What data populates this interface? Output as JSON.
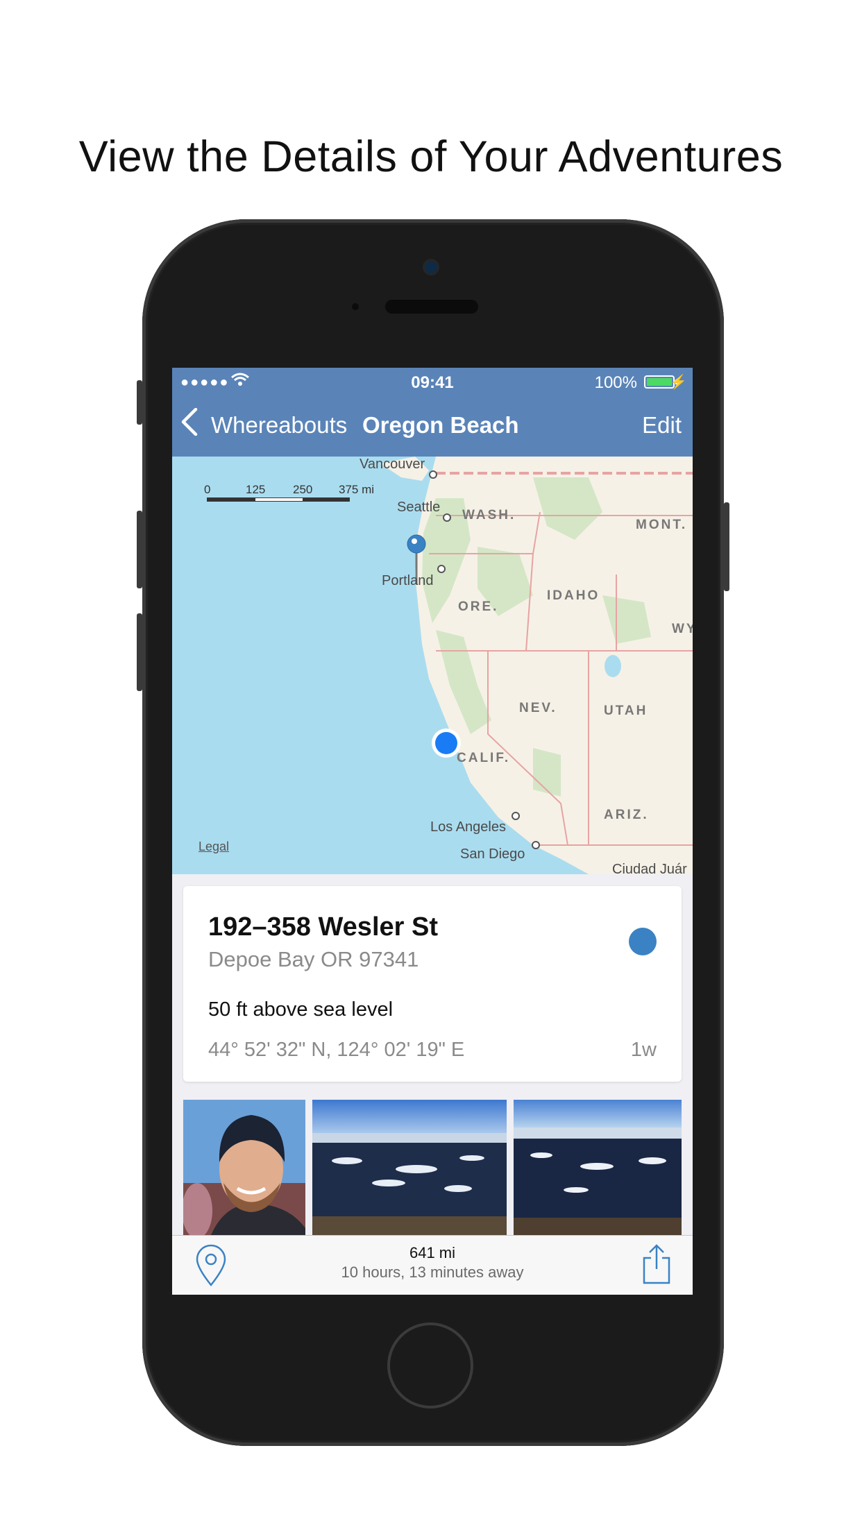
{
  "headline": "View the Details of Your Adventures",
  "status_bar": {
    "signal": "●●●●●",
    "time": "09:41",
    "battery": "100%"
  },
  "nav": {
    "back_label": "Whereabouts",
    "title": "Oregon Beach",
    "edit": "Edit"
  },
  "map": {
    "scale": [
      "0",
      "125",
      "250",
      "375 mi"
    ],
    "cities": [
      "Vancouver",
      "Seattle",
      "Portland",
      "Los Angeles",
      "San Diego",
      "Ciudad Juár"
    ],
    "states": [
      "WASH.",
      "MONT.",
      "IDAHO",
      "ORE.",
      "WY",
      "NEV.",
      "UTAH",
      "CALIF.",
      "ARIZ."
    ],
    "legal": "Legal"
  },
  "location": {
    "address": "192–358 Wesler St",
    "city": "Depoe Bay OR 97341",
    "elevation": "50 ft above sea level",
    "coordinates": "44° 52' 32\" N, 124° 02' 19\" E",
    "ago": "1w",
    "accent_color": "#3a82c4"
  },
  "trip": {
    "distance": "641 mi",
    "eta": "10 hours, 13 minutes away"
  },
  "colors": {
    "navbar": "#5a84b8",
    "water": "#aadcef",
    "land": "#f6f1e6",
    "current_location": "#1a7cf5"
  }
}
